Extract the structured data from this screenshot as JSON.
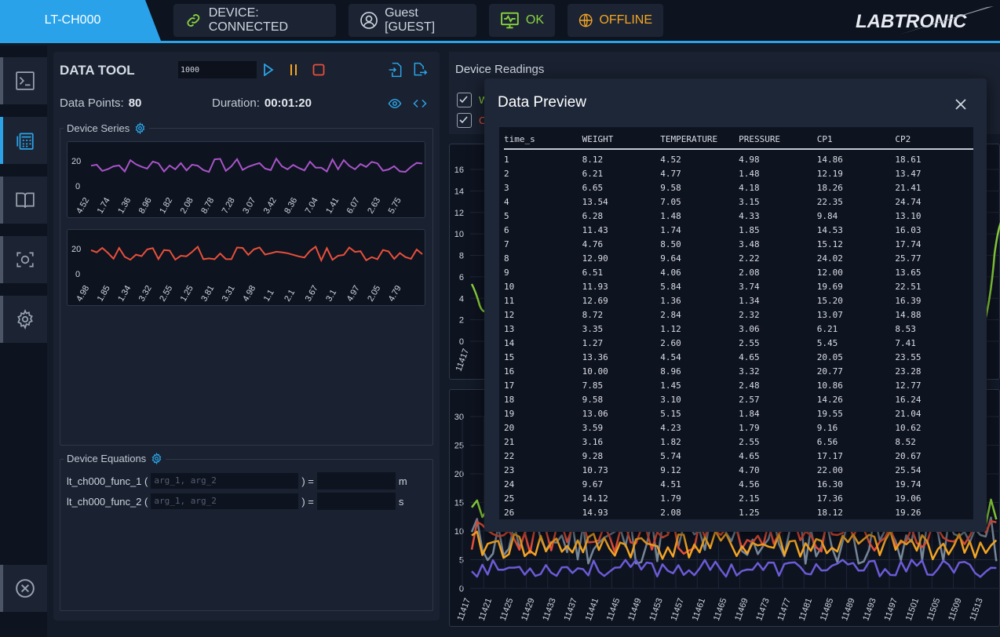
{
  "header": {
    "device_tab": "LT-CH000",
    "connection": "DEVICE: CONNECTED",
    "user": "Guest [GUEST]",
    "status": "OK",
    "network": "OFFLINE",
    "brand": "LABTRONIC"
  },
  "colors": {
    "accent": "#2ba3e6",
    "ok": "#8ad43c",
    "warn": "#f5a623",
    "purple": "#a855c8",
    "red": "#e8503a",
    "gray": "#778899"
  },
  "sidebar": {
    "items": [
      {
        "icon": "terminal-icon"
      },
      {
        "icon": "calculator-icon"
      },
      {
        "icon": "book-icon"
      },
      {
        "icon": "screenshot-icon"
      },
      {
        "icon": "gear-icon"
      },
      {
        "icon": "close-circle-icon"
      }
    ]
  },
  "data_tool": {
    "title": "DATA TOOL",
    "rate_value": "1000",
    "data_points_label": "Data Points:",
    "data_points": "80",
    "duration_label": "Duration:",
    "duration": "00:01:20",
    "series_title": "Device Series",
    "equations_title": "Device Equations"
  },
  "series1": {
    "y_ticks": [
      "20",
      "0"
    ],
    "x_ticks": [
      "4.52",
      "1.74",
      "1.36",
      "8.96",
      "1.82",
      "2.08",
      "8.78",
      "7.28",
      "3.07",
      "3.42",
      "8.36",
      "7.04",
      "1.41",
      "6.07",
      "2.63",
      "5.75"
    ]
  },
  "series2": {
    "y_ticks": [
      "20",
      "0"
    ],
    "x_ticks": [
      "4.98",
      "1.85",
      "1.34",
      "3.32",
      "2.55",
      "1.25",
      "3.81",
      "3.31",
      "4.98",
      "1.1",
      "2.1",
      "3.67",
      "3.1",
      "4.97",
      "2.05",
      "4.79"
    ]
  },
  "equations": [
    {
      "name": "lt_ch000_func_1 (",
      "placeholder": "arg_1, arg_2",
      "eq": ") =",
      "unit": "m"
    },
    {
      "name": "lt_ch000_func_2 (",
      "placeholder": "arg_1, arg_2",
      "eq": ") =",
      "unit": "s"
    }
  ],
  "readings": {
    "title": "Device Readings",
    "item1_partial": "W",
    "item2_partial": "C"
  },
  "chart_top": {
    "y_ticks": [
      "16",
      "14",
      "12",
      "10",
      "8",
      "6",
      "4",
      "2",
      "0"
    ],
    "x_first": "11417"
  },
  "chart_bottom": {
    "y_ticks": [
      "30",
      "25",
      "20",
      "15",
      "10",
      "5",
      "0"
    ],
    "x_ticks": [
      "11417",
      "11421",
      "11425",
      "11429",
      "11433",
      "11437",
      "11441",
      "11445",
      "11449",
      "11453",
      "11457",
      "11461",
      "11465",
      "11469",
      "11473",
      "11477",
      "11481",
      "11485",
      "11489",
      "11493",
      "11497",
      "11501",
      "11505",
      "11509",
      "11513"
    ]
  },
  "preview": {
    "title": "Data Preview",
    "columns": [
      "time_s",
      "WEIGHT",
      "TEMPERATURE",
      "PRESSURE",
      "CP1",
      "CP2"
    ],
    "rows": [
      [
        "1",
        "8.12",
        "4.52",
        "4.98",
        "14.86",
        "18.61"
      ],
      [
        "2",
        "6.21",
        "4.77",
        "1.48",
        "12.19",
        "13.47"
      ],
      [
        "3",
        "6.65",
        "9.58",
        "4.18",
        "18.26",
        "21.41"
      ],
      [
        "4",
        "13.54",
        "7.05",
        "3.15",
        "22.35",
        "24.74"
      ],
      [
        "5",
        "6.28",
        "1.48",
        "4.33",
        "9.84",
        "13.10"
      ],
      [
        "6",
        "11.43",
        "1.74",
        "1.85",
        "14.53",
        "16.03"
      ],
      [
        "7",
        "4.76",
        "8.50",
        "3.48",
        "15.12",
        "17.74"
      ],
      [
        "8",
        "12.90",
        "9.64",
        "2.22",
        "24.02",
        "25.77"
      ],
      [
        "9",
        "6.51",
        "4.06",
        "2.08",
        "12.00",
        "13.65"
      ],
      [
        "10",
        "11.93",
        "5.84",
        "3.74",
        "19.69",
        "22.51"
      ],
      [
        "11",
        "12.69",
        "1.36",
        "1.34",
        "15.20",
        "16.39"
      ],
      [
        "12",
        "8.72",
        "2.84",
        "2.32",
        "13.07",
        "14.88"
      ],
      [
        "13",
        "3.35",
        "1.12",
        "3.06",
        "6.21",
        "8.53"
      ],
      [
        "14",
        "1.27",
        "2.60",
        "2.55",
        "5.45",
        "7.41"
      ],
      [
        "15",
        "13.36",
        "4.54",
        "4.65",
        "20.05",
        "23.55"
      ],
      [
        "16",
        "10.00",
        "8.96",
        "3.32",
        "20.77",
        "23.28"
      ],
      [
        "17",
        "7.85",
        "1.45",
        "2.48",
        "10.86",
        "12.77"
      ],
      [
        "18",
        "9.58",
        "3.10",
        "2.57",
        "14.26",
        "16.24"
      ],
      [
        "19",
        "13.06",
        "5.15",
        "1.84",
        "19.55",
        "21.04"
      ],
      [
        "20",
        "3.59",
        "4.23",
        "1.79",
        "9.16",
        "10.62"
      ],
      [
        "21",
        "3.16",
        "1.82",
        "2.55",
        "6.56",
        "8.52"
      ],
      [
        "22",
        "9.28",
        "5.74",
        "4.65",
        "17.17",
        "20.67"
      ],
      [
        "23",
        "10.73",
        "9.12",
        "4.70",
        "22.00",
        "25.54"
      ],
      [
        "24",
        "9.67",
        "4.51",
        "4.56",
        "16.30",
        "19.74"
      ],
      [
        "25",
        "14.12",
        "1.79",
        "2.15",
        "17.36",
        "19.06"
      ],
      [
        "26",
        "14.93",
        "2.08",
        "1.25",
        "18.12",
        "19.26"
      ]
    ]
  }
}
